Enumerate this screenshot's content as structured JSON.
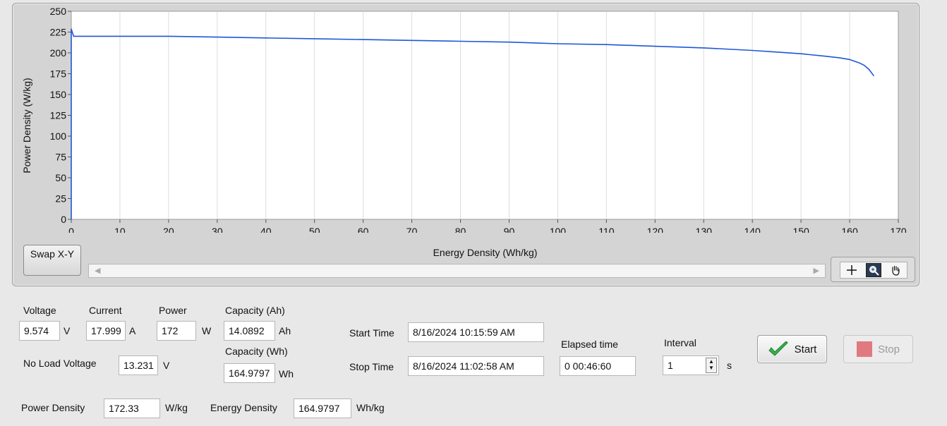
{
  "graph": {
    "y_axis_label": "Power Density (W/kg)",
    "x_axis_label": "Energy Density (Wh/kg)",
    "swap_button_label": "Swap X-Y",
    "x_ticks": [
      "0",
      "10",
      "20",
      "30",
      "40",
      "50",
      "60",
      "70",
      "80",
      "90",
      "100",
      "110",
      "120",
      "130",
      "140",
      "150",
      "160",
      "170"
    ],
    "y_ticks": [
      "0",
      "25",
      "50",
      "75",
      "100",
      "125",
      "150",
      "175",
      "200",
      "225",
      "250"
    ],
    "palette_tools": [
      "cursor-tool",
      "zoom-tool",
      "pan-tool"
    ]
  },
  "chart_data": {
    "type": "line",
    "title": "",
    "xlabel": "Energy Density (Wh/kg)",
    "ylabel": "Power Density (W/kg)",
    "xlim": [
      0,
      170
    ],
    "ylim": [
      0,
      250
    ],
    "grid": true,
    "series": [
      {
        "color": "#1f57d6",
        "x": [
          0,
          0,
          0.2,
          0.5,
          1,
          5,
          10,
          20,
          30,
          40,
          50,
          60,
          70,
          80,
          90,
          100,
          110,
          120,
          130,
          140,
          145,
          150,
          155,
          158,
          160,
          162,
          163,
          164,
          164.98
        ],
        "y": [
          0,
          229,
          225,
          220,
          220,
          220,
          220,
          220,
          219,
          218,
          217,
          216,
          215,
          214,
          213,
          211,
          210,
          208,
          206,
          203,
          201,
          199,
          196,
          194,
          192,
          188,
          185,
          180,
          172.33
        ]
      }
    ]
  },
  "readouts": {
    "voltage_label": "Voltage",
    "voltage_value": "9.574",
    "voltage_unit": "V",
    "current_label": "Current",
    "current_value": "17.999",
    "current_unit": "A",
    "power_label": "Power",
    "power_value": "172",
    "power_unit": "W",
    "capacity_ah_label": "Capacity (Ah)",
    "capacity_ah_value": "14.0892",
    "capacity_ah_unit": "Ah",
    "capacity_wh_label": "Capacity (Wh)",
    "capacity_wh_value": "164.9797",
    "capacity_wh_unit": "Wh",
    "no_load_voltage_label": "No Load Voltage",
    "no_load_voltage_value": "13.231",
    "no_load_voltage_unit": "V",
    "start_time_label": "Start Time",
    "start_time_value": "8/16/2024 10:15:59 AM",
    "stop_time_label": "Stop Time",
    "stop_time_value": "8/16/2024 11:02:58 AM",
    "elapsed_time_label": "Elapsed time",
    "elapsed_time_value": "0 00:46:60",
    "interval_label": "Interval",
    "interval_value": "1",
    "interval_unit": "s",
    "power_density_label": "Power Density",
    "power_density_value": "172.33",
    "power_density_unit": "W/kg",
    "energy_density_label": "Energy Density",
    "energy_density_value": "164.9797",
    "energy_density_unit": "Wh/kg"
  },
  "buttons": {
    "start_label": "Start",
    "stop_label": "Stop"
  },
  "colors": {
    "trace": "#1f57d6",
    "plot_bg": "#ffffff",
    "panel_bg": "#e8e8e8",
    "stop_indicator": "#e07a80"
  }
}
